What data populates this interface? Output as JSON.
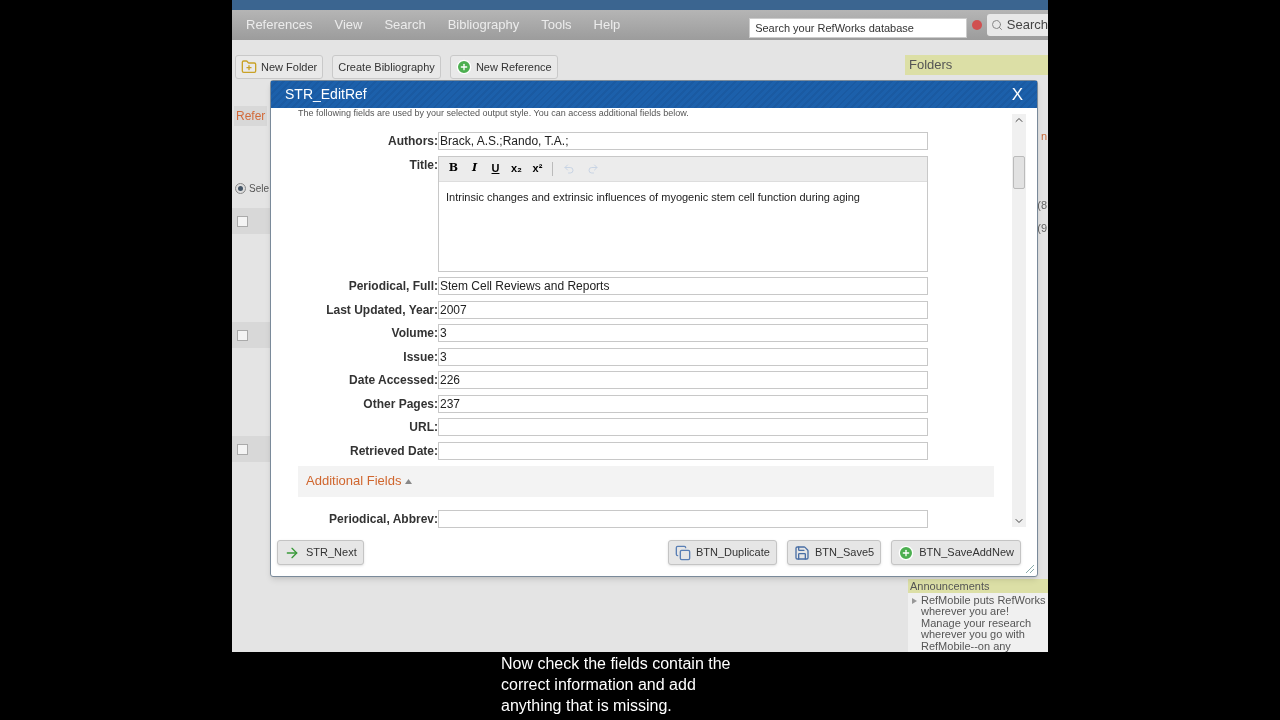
{
  "menu": [
    "References",
    "View",
    "Search",
    "Bibliography",
    "Tools",
    "Help"
  ],
  "search": {
    "placeholder": "Search your RefWorks database",
    "button": "Search"
  },
  "toolbar": [
    {
      "label": "New Folder",
      "kind": "folder"
    },
    {
      "label": "Create Bibliography",
      "kind": "plain"
    },
    {
      "label": "New Reference",
      "kind": "add"
    }
  ],
  "left_panel": {
    "tab": "Refer",
    "radio": {
      "label": "Sele",
      "selected": true
    },
    "rows": [
      {
        "checked": false
      },
      {
        "checked": false
      },
      {
        "checked": false
      }
    ]
  },
  "sidebar": {
    "title": "Folders",
    "items": [
      {
        "text": "n",
        "kind": "link"
      },
      {
        "text": "(8",
        "kind": "count"
      },
      {
        "text": "(9",
        "kind": "count"
      }
    ],
    "announcements": {
      "title": "Announcements",
      "text": "RefMobile puts RefWorks wherever you are! Manage your research wherever you go with RefMobile--on any"
    }
  },
  "dialog": {
    "title": "STR_EditRef",
    "close": "X",
    "intro": "The following fields are used by your selected output style. You can access additional fields below.",
    "fields": [
      {
        "kind": "text",
        "label": "Authors:",
        "value": "Brack, A.S.;Rando, T.A.;"
      },
      {
        "kind": "rich",
        "label": "Title:",
        "toolbar": [
          "B",
          "I",
          "U",
          "x₂",
          "x²"
        ],
        "value": "Intrinsic changes and extrinsic influences of myogenic stem cell function during aging"
      },
      {
        "kind": "text",
        "label": "Periodical, Full:",
        "value": "Stem Cell Reviews and Reports"
      },
      {
        "kind": "text",
        "label": "Last Updated, Year:",
        "value": "2007"
      },
      {
        "kind": "text",
        "label": "Volume:",
        "value": "3"
      },
      {
        "kind": "text",
        "label": "Issue:",
        "value": "3"
      },
      {
        "kind": "text",
        "label": "Date Accessed:",
        "value": "226"
      },
      {
        "kind": "text",
        "label": "Other Pages:",
        "value": "237"
      },
      {
        "kind": "text",
        "label": "URL:"
      },
      {
        "kind": "text",
        "label": "Retrieved Date:"
      }
    ],
    "additional": {
      "label": "Additional Fields",
      "expanded": true,
      "fields": [
        {
          "kind": "text",
          "label": "Periodical, Abbrev:"
        }
      ]
    },
    "next": {
      "label": "STR_Next",
      "kind": "next"
    },
    "buttons": [
      {
        "label": "BTN_Duplicate",
        "kind": "duplicate"
      },
      {
        "label": "BTN_Save5",
        "kind": "save"
      },
      {
        "label": "BTN_SaveAddNew",
        "kind": "add"
      }
    ]
  },
  "subtitle": [
    "Now check the fields contain the",
    "correct information and add",
    "anything that is missing."
  ]
}
